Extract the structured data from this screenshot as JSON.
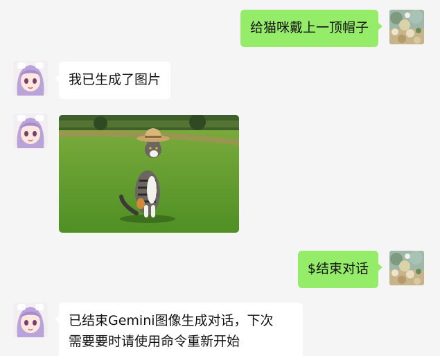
{
  "messages": [
    {
      "id": "m1",
      "sender": "user",
      "type": "text",
      "text": "给猫咪戴上一顶帽子"
    },
    {
      "id": "m2",
      "sender": "bot",
      "type": "text",
      "text": "我已生成了图片"
    },
    {
      "id": "m3",
      "sender": "bot",
      "type": "image",
      "image_name": "cat-with-straw-hat"
    },
    {
      "id": "m4",
      "sender": "user",
      "type": "text",
      "text": "$结束对话"
    },
    {
      "id": "m5",
      "sender": "bot",
      "type": "text",
      "lines": [
        "已结束Gemini图像生成对话，下次",
        "需要要时请使用命令重新开始"
      ]
    }
  ],
  "colors": {
    "background": "#f5f5f5",
    "outgoing_bubble": "#95ec69",
    "incoming_bubble": "#ffffff"
  },
  "icons": {
    "user_avatar": "flower-field-avatar",
    "bot_avatar": "anime-girl-avatar"
  }
}
